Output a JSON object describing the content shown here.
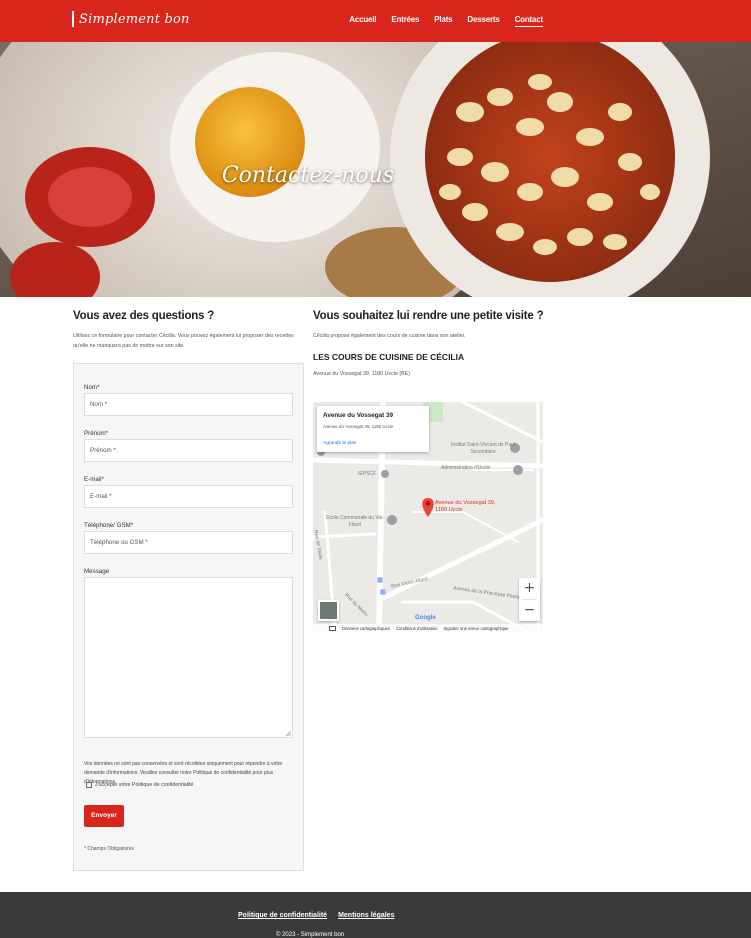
{
  "header": {
    "logo": "Simplement bon",
    "nav": [
      "Accueil",
      "Entrées",
      "Plats",
      "Desserts",
      "Contact"
    ],
    "active": "Contact"
  },
  "hero": {
    "title": "Contactez-nous"
  },
  "contact_form": {
    "title": "Vous avez des questions ?",
    "intro": "Utilisez ce formulaire pour contacter Cécilia. Vous pouvez également lui proposer des recettes qu'elle ne manquera pas de mettre sur son site.",
    "fields": {
      "nom": {
        "label": "Nom*",
        "placeholder": "Nom *"
      },
      "prenom": {
        "label": "Prénom*",
        "placeholder": "Prénom *"
      },
      "email": {
        "label": "E-mail*",
        "placeholder": "E-mail *"
      },
      "telephone": {
        "label": "Téléphone/ GSM*",
        "placeholder": "Téléphone ou GSM *"
      },
      "message": {
        "label": "Message"
      }
    },
    "privacy_notice": "Vos données ne sont pas conservées et sont récoltées uniquement pour répondre à votre demande d'informations. Veuillez consulter notre Politique de confidentialité pour plus d'informations.",
    "consent": "J'accepte votre Politique de confidentialité",
    "submit": "Envoyer",
    "required_note": "* Champs Obligatoires"
  },
  "visit": {
    "title": "Vous souhaitez lui rendre une petite visite ?",
    "intro": "Cécilia propose également des cours de cuisine dans son atelier.",
    "atelier_title": "LES COURS DE CUISINE DE CÉCILIA",
    "address": "Avenue du Vossegat 39, 1180 Uccle (BE)"
  },
  "map": {
    "card_title": "Avenue du Vossegat 39",
    "card_subtitle": "Avenue du Vossegat 39, 1180 Uccle",
    "card_link": "Agrandir le plan",
    "pin_label": "Avenue du Vossegat 39, 1180 Uccle",
    "places": [
      "Institut Saint-Vincent de Paul Secondaire",
      "Administration d'Uccle",
      "IEPSCF",
      "Ecole Communale du Val-Fleuri"
    ],
    "streets": [
      "Rue Victor Allard",
      "Avenue de la Princesse Paola",
      "Rue du Merlo",
      "Rue de Stalle"
    ],
    "zoom_in": "+",
    "zoom_out": "−",
    "google": "Google",
    "footer": [
      "Données cartographiques",
      "Conditions d'utilisation",
      "Signaler une erreur cartographique"
    ]
  },
  "footer": {
    "links": [
      "Politique de confidentialité",
      "Mentions légales"
    ],
    "copyright": "© 2023 - Simplement bon"
  }
}
